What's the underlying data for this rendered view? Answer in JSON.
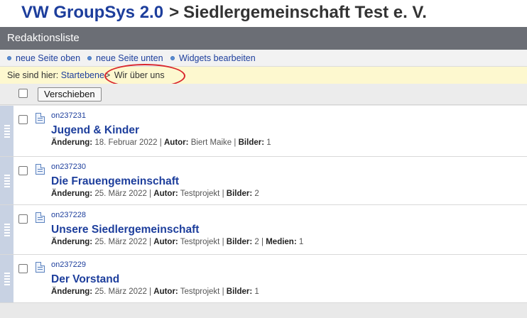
{
  "header": {
    "app_name": "VW GroupSys 2.0",
    "separator": ">",
    "org_name": "Siedlergemeinschaft Test e. V."
  },
  "title_bar": {
    "title": "Redaktionsliste"
  },
  "actions": [
    {
      "label": "neue Seite oben",
      "icon": "bullet-icon"
    },
    {
      "label": "neue Seite unten",
      "icon": "bullet-icon"
    },
    {
      "label": "Widgets bearbeiten",
      "icon": "bullet-icon"
    }
  ],
  "breadcrumb": {
    "prefix": "Sie sind hier:",
    "root_link": "Startebene",
    "arrow": ">",
    "current": "Wir über uns"
  },
  "toolbar": {
    "move_button": "Verschieben"
  },
  "labels": {
    "changed": "Änderung:",
    "author": "Autor:",
    "images": "Bilder:",
    "media": "Medien:",
    "pipe": "|"
  },
  "pages": [
    {
      "id": "on237231",
      "title": "Jugend & Kinder",
      "changed": "18. Februar 2022",
      "author": "Biert Maike",
      "images": "1"
    },
    {
      "id": "on237230",
      "title": "Die Frauengemeinschaft",
      "changed": "25. März 2022",
      "author": "Testprojekt",
      "images": "2"
    },
    {
      "id": "on237228",
      "title": "Unsere Siedlergemeinschaft",
      "changed": "25. März 2022",
      "author": "Testprojekt",
      "images": "2",
      "media": "1"
    },
    {
      "id": "on237229",
      "title": "Der Vorstand",
      "changed": "25. März 2022",
      "author": "Testprojekt",
      "images": "1"
    }
  ],
  "colors": {
    "accent": "#1d3e9c",
    "title_bar": "#6b6e75",
    "breadcrumb_bg": "#fdf8cf",
    "highlight_ring": "#d9262d",
    "drag_handle": "#c8d2e3"
  }
}
